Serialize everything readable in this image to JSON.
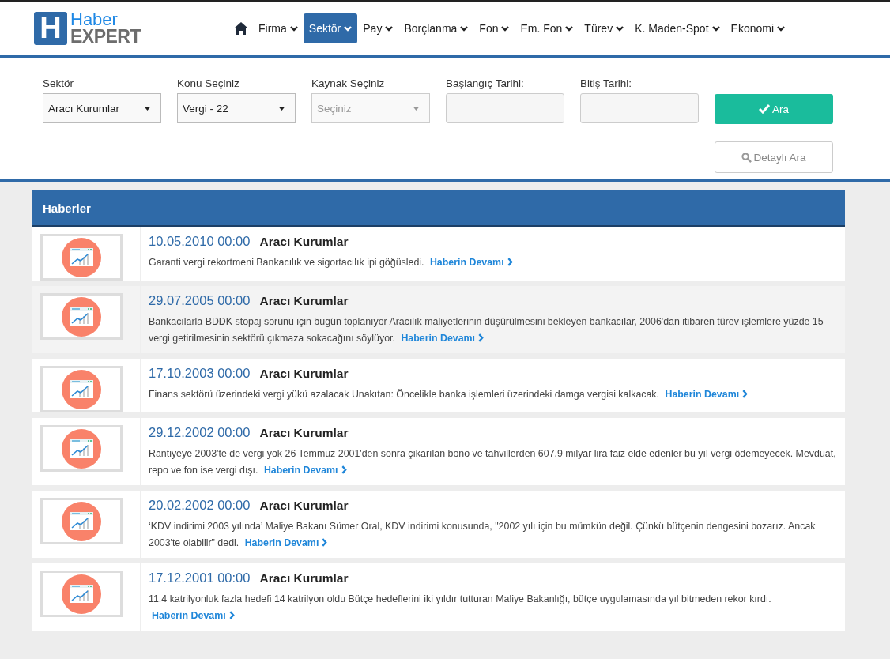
{
  "logo": {
    "mark": "H",
    "line1": "Haber",
    "line2": "EXPERT"
  },
  "nav": [
    {
      "label": "Firma",
      "selected": false
    },
    {
      "label": "Sektör",
      "selected": true
    },
    {
      "label": "Pay",
      "selected": false
    },
    {
      "label": "Borçlanma",
      "selected": false
    },
    {
      "label": "Fon",
      "selected": false
    },
    {
      "label": "Em. Fon",
      "selected": false
    },
    {
      "label": "Türev",
      "selected": false
    },
    {
      "label": "K. Maden-Spot",
      "selected": false
    },
    {
      "label": "Ekonomi",
      "selected": false
    }
  ],
  "filters": [
    {
      "kind": "select",
      "label": "Sektör",
      "value": "Aracı Kurumlar",
      "disabled": false
    },
    {
      "kind": "select",
      "label": "Konu Seçiniz",
      "value": "Vergi - 22",
      "disabled": false
    },
    {
      "kind": "select",
      "label": "Kaynak Seçiniz",
      "placeholder": "Seçiniz",
      "disabled": true
    },
    {
      "kind": "date",
      "label": "Başlangıç Tarihi:"
    },
    {
      "kind": "date",
      "label": "Bitiş Tarihi:"
    }
  ],
  "search_button": "Ara",
  "detail_button": "Detaylı Ara",
  "news": {
    "title": "Haberler",
    "items": [
      {
        "date": "10.05.2010 00:00",
        "sector": "Aracı Kurumlar",
        "summary": "Garanti vergi rekortmeni Bankacılık ve sigortacılık ipi göğüsledi.",
        "more_label": "Haberin Devamı",
        "highlighted": false
      },
      {
        "date": "29.07.2005 00:00",
        "sector": "Aracı Kurumlar",
        "summary": "Bankacılarla BDDK stopaj sorunu için bugün toplanıyor Aracılık maliyetlerinin düşürülmesini bekleyen bankacılar, 2006'dan itibaren türev işlemlere yüzde 15 vergi getirilmesinin sektörü çıkmaza sokacağını söylüyor.",
        "more_label": "Haberin Devamı",
        "highlighted": true
      },
      {
        "date": "17.10.2003 00:00",
        "sector": "Aracı Kurumlar",
        "summary": "Finans sektörü üzerindeki vergi yükü azalacak Unakıtan: Öncelikle banka işlemleri üzerindeki damga vergisi kalkacak.",
        "more_label": "Haberin Devamı",
        "highlighted": false
      },
      {
        "date": "29.12.2002 00:00",
        "sector": "Aracı Kurumlar",
        "summary": "Rantiyeye 2003'te de vergi yok 26 Temmuz 2001'den sonra çıkarılan bono ve tahvillerden 607.9 milyar lira faiz elde edenler bu yıl vergi ödemeyecek. Mevduat, repo ve fon ise vergi dışı.",
        "more_label": "Haberin Devamı",
        "highlighted": false
      },
      {
        "date": "20.02.2002 00:00",
        "sector": "Aracı Kurumlar",
        "summary": "‘KDV indirimi 2003 yılında’ Maliye Bakanı Sümer Oral, KDV indirimi konusunda, \"2002 yılı için bu mümkün değil. Çünkü bütçenin dengesini bozarız. Ancak 2003'te olabilir\" dedi.",
        "more_label": "Haberin Devamı",
        "highlighted": false
      },
      {
        "date": "17.12.2001 00:00",
        "sector": "Aracı Kurumlar",
        "summary": "11.4 katrilyonluk fazla hedefi 14 katrilyon oldu Bütçe hedeflerini iki yıldır tutturan Maliye Bakanlığı, bütçe uygulamasında yıl bitmeden rekor kırdı.",
        "more_label": "Haberin Devamı",
        "highlighted": false
      }
    ]
  }
}
